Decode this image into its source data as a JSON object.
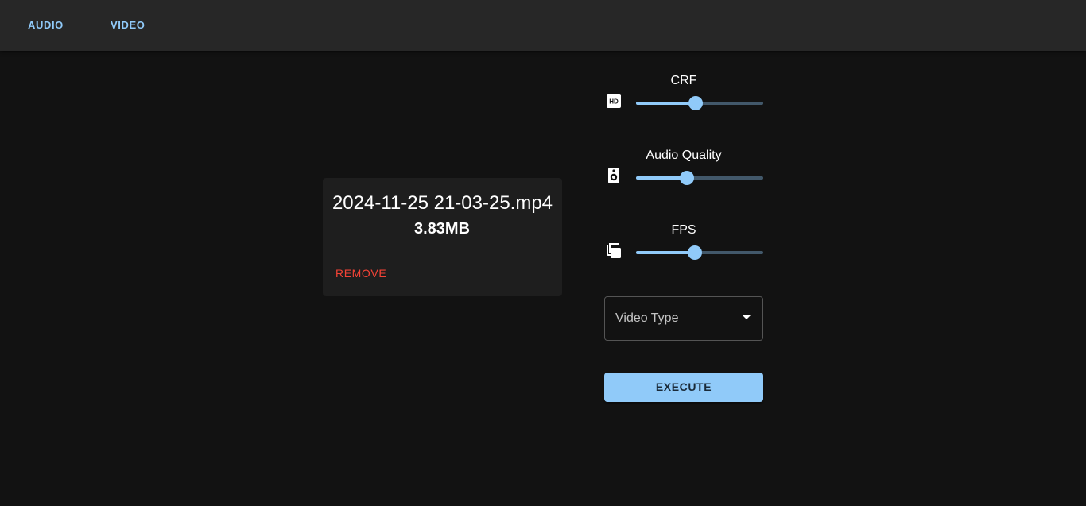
{
  "tabs": [
    {
      "label": "AUDIO"
    },
    {
      "label": "VIDEO"
    }
  ],
  "file": {
    "name": "2024-11-25 21-03-25.mp4",
    "size": "3.83MB",
    "remove_label": "REMOVE"
  },
  "controls": {
    "crf": {
      "label": "CRF",
      "icon": "hd-icon",
      "fraction": 0.47
    },
    "audio_quality": {
      "label": "Audio Quality",
      "icon": "speaker-icon",
      "fraction": 0.4
    },
    "fps": {
      "label": "FPS",
      "icon": "copy-layers-icon",
      "fraction": 0.46
    }
  },
  "video_type": {
    "label": "Video Type"
  },
  "execute_label": "EXECUTE",
  "colors": {
    "accent": "#90caf9",
    "danger": "#f44336",
    "background": "#121212",
    "appbar": "#272727",
    "card": "#1e1e1e"
  }
}
